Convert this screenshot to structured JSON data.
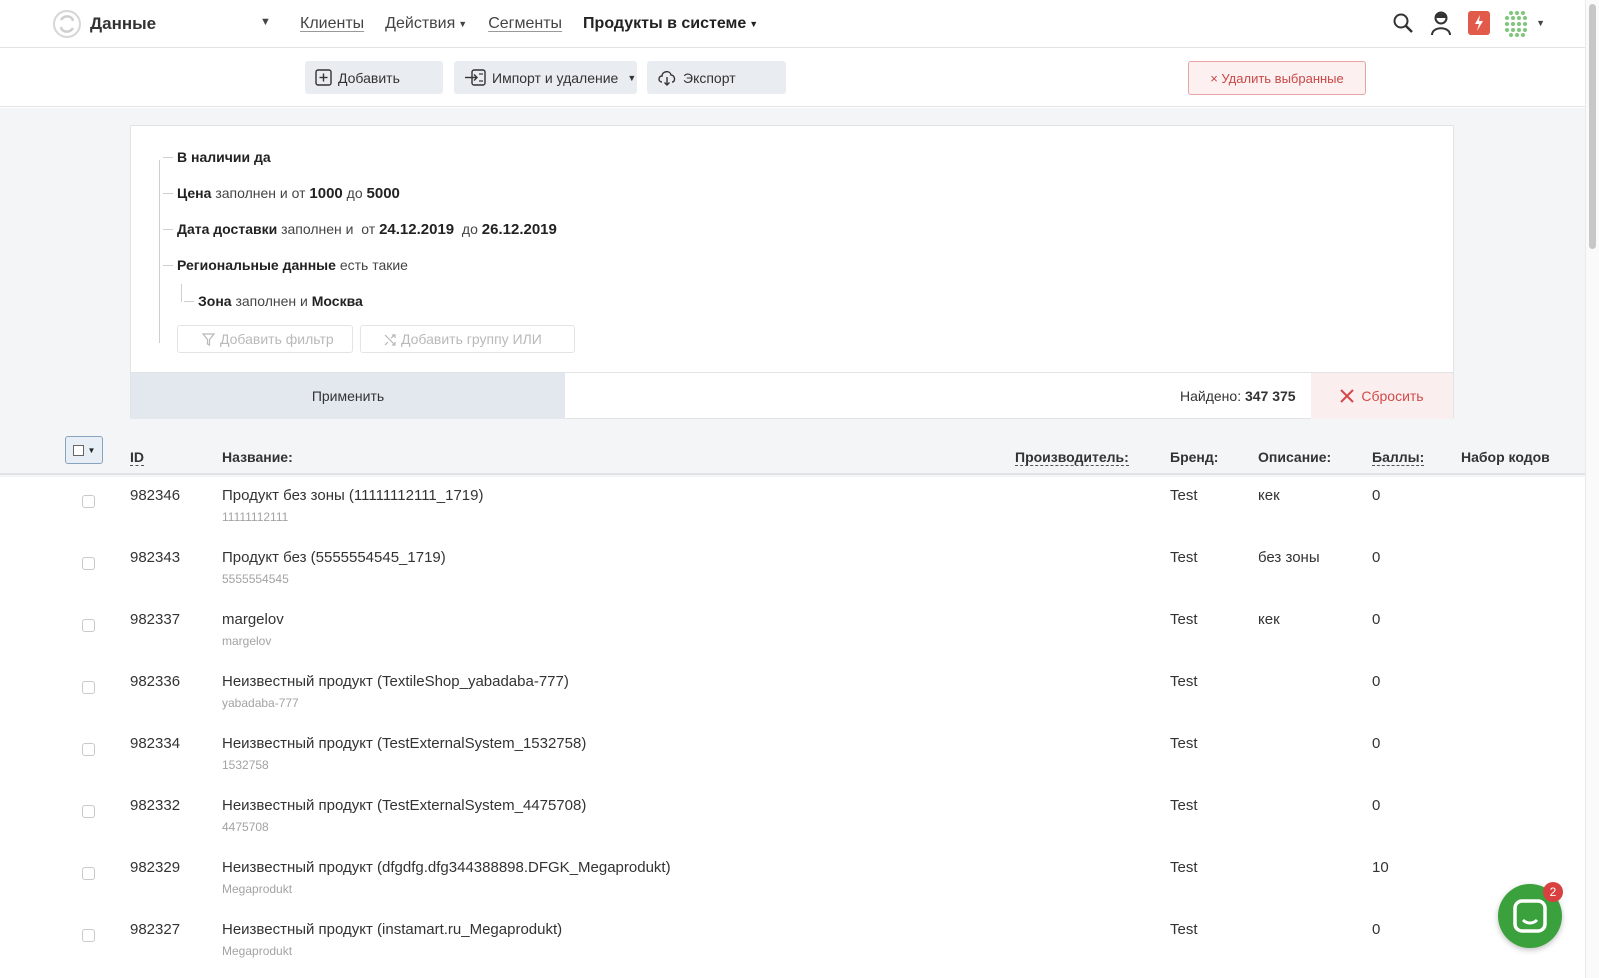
{
  "header": {
    "app_title": "Данные",
    "nav": [
      {
        "label": "Клиенты",
        "kind": "link"
      },
      {
        "label": "Действия",
        "kind": "dropdown"
      },
      {
        "label": "Сегменты",
        "kind": "link"
      },
      {
        "label": "Продукты в системе",
        "kind": "active-dropdown"
      }
    ],
    "icons": [
      "search-icon",
      "user-icon",
      "notification-icon",
      "apps-grid-icon"
    ]
  },
  "toolbar": {
    "add_label": "Добавить",
    "import_label": "Импорт и удаление",
    "export_label": "Экспорт",
    "delete_selected_label": "× Удалить выбранные"
  },
  "filters": {
    "f1": {
      "field": "В наличии",
      "value": "да"
    },
    "f2": {
      "field": "Цена",
      "op": "заполнен и",
      "from_word": "от",
      "from": "1000",
      "to_word": "до",
      "to": "5000"
    },
    "f3": {
      "field": "Дата доставки",
      "op": "заполнен и",
      "from_word": "от",
      "from": "24.12.2019",
      "to_word": "до",
      "to": "26.12.2019"
    },
    "f4": {
      "field": "Региональные данные",
      "op": "есть такие"
    },
    "f5": {
      "field": "Зона",
      "op": "заполнен и",
      "value": "Москва"
    },
    "add_filter_label": "Добавить фильтр",
    "add_or_group_label": "Добавить группу ИЛИ",
    "apply_label": "Применить",
    "found_label": "Найдено:",
    "found_count": "347 375",
    "reset_label": "Сбросить"
  },
  "table": {
    "columns": {
      "id": "ID",
      "name": "Название:",
      "manufacturer": "Производитель:",
      "brand": "Бренд:",
      "description": "Описание:",
      "points": "Баллы:",
      "codes": "Набор кодов"
    },
    "rows": [
      {
        "id": "982346",
        "name": "Продукт без зоны (11111112111_1719)",
        "sub": "11111112111",
        "brand": "Test",
        "description": "кек",
        "points": "0"
      },
      {
        "id": "982343",
        "name": "Продукт без (5555554545_1719)",
        "sub": "5555554545",
        "brand": "Test",
        "description": "без зоны",
        "points": "0"
      },
      {
        "id": "982337",
        "name": "margelov",
        "sub": "margelov",
        "brand": "Test",
        "description": "кек",
        "points": "0"
      },
      {
        "id": "982336",
        "name": "Неизвестный продукт (TextileShop_yabadaba-777)",
        "sub": "yabadaba-777",
        "brand": "Test",
        "description": "",
        "points": "0"
      },
      {
        "id": "982334",
        "name": "Неизвестный продукт (TestExternalSystem_1532758)",
        "sub": "1532758",
        "brand": "Test",
        "description": "",
        "points": "0"
      },
      {
        "id": "982332",
        "name": "Неизвестный продукт (TestExternalSystem_4475708)",
        "sub": "4475708",
        "brand": "Test",
        "description": "",
        "points": "0"
      },
      {
        "id": "982329",
        "name": "Неизвестный продукт (dfgdfg.dfg344388898.DFGK_Megaprodukt)",
        "sub": "Megaprodukt",
        "brand": "Test",
        "description": "",
        "points": "10"
      },
      {
        "id": "982327",
        "name": "Неизвестный продукт (instamart.ru_Megaprodukt)",
        "sub": "Megaprodukt",
        "brand": "Test",
        "description": "",
        "points": "0"
      }
    ]
  },
  "chat": {
    "badge": "2"
  },
  "colors": {
    "accent_green": "#3aa13c",
    "danger": "#d24a4a",
    "badge": "#d94040"
  }
}
